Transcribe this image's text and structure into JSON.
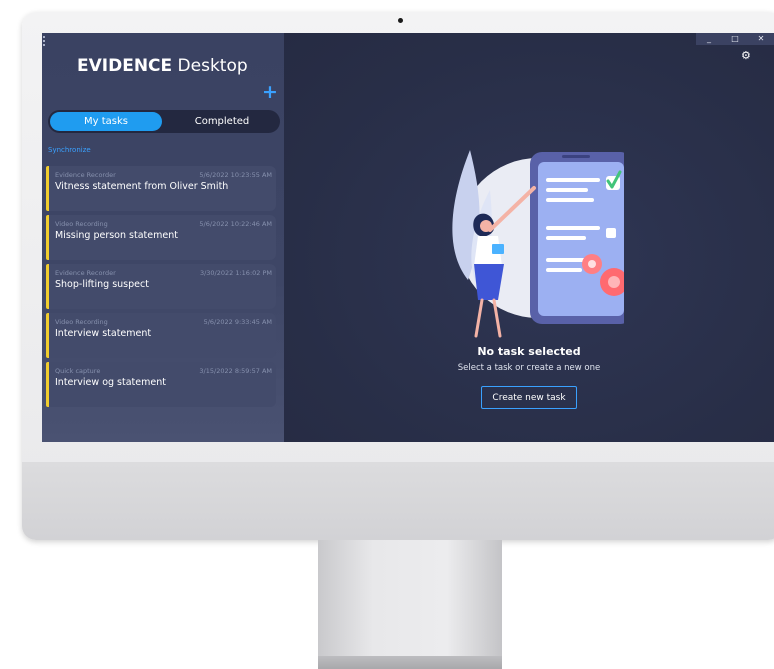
{
  "app": {
    "title_bold": "EVIDENCE",
    "title_light": "Desktop"
  },
  "window_controls": {
    "minimize": "_",
    "maximize": "□",
    "close": "✕"
  },
  "tabs": [
    {
      "label": "My tasks",
      "active": true
    },
    {
      "label": "Completed",
      "active": false
    }
  ],
  "sync_label": "Synchronize",
  "tasks": [
    {
      "type": "Evidence Recorder",
      "date": "5/6/2022 10:23:55 AM",
      "title": "Vitness statement from Oliver Smith"
    },
    {
      "type": "Video Recording",
      "date": "5/6/2022 10:22:46 AM",
      "title": "Missing person statement"
    },
    {
      "type": "Evidence Recorder",
      "date": "3/30/2022 1:16:02 PM",
      "title": "Shop-lifting suspect"
    },
    {
      "type": "Video Recording",
      "date": "5/6/2022 9:33:45 AM",
      "title": "Interview statement"
    },
    {
      "type": "Quick capture",
      "date": "3/15/2022 8:59:57 AM",
      "title": "Interview og statement"
    }
  ],
  "empty_state": {
    "title": "No task selected",
    "subtitle": "Select a task or create a new one",
    "button_label": "Create new task"
  },
  "colors": {
    "accent": "#1f9cf0",
    "task_stripe": "#f1cd2e",
    "sidebar_bg": "#3c4464",
    "main_bg": "#2b3149"
  },
  "icons": {
    "menu": "dots-icon",
    "add": "plus-icon",
    "settings": "gear-icon"
  }
}
